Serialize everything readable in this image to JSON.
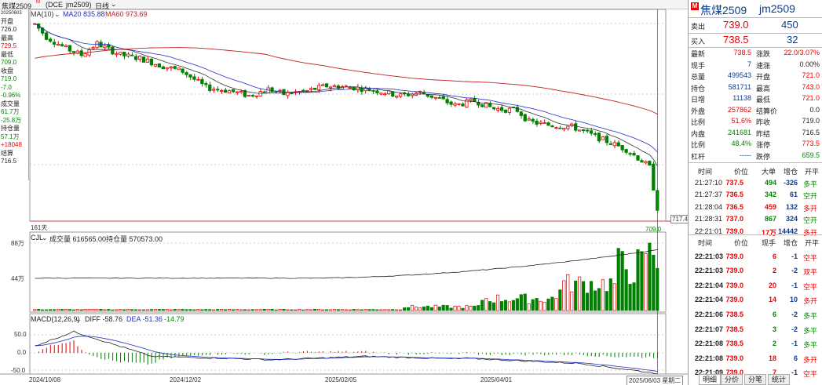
{
  "topbar": {
    "title": "焦煤2509",
    "title_sup": "M",
    "exchange": "(DCE",
    "symbol": "jm2509)",
    "period": "日线",
    "ma10": "MA(10)",
    "ma20": "MA20 835.88",
    "ma60": "MA60 973.69"
  },
  "ohlc_panel": [
    {
      "text": "20250603",
      "color": "#222"
    },
    {
      "text": "开盘",
      "color": "#222"
    },
    {
      "text": "726.0",
      "color": "#222"
    },
    {
      "text": "最高",
      "color": "#222"
    },
    {
      "text": "729.5",
      "color": "#e00"
    },
    {
      "text": "最低",
      "color": "#222"
    },
    {
      "text": "709.0",
      "color": "#080"
    },
    {
      "text": "收盘",
      "color": "#222"
    },
    {
      "text": "719.0",
      "color": "#080"
    },
    {
      "text": "-7.0",
      "color": "#080"
    },
    {
      "text": "-0.96%",
      "color": "#080"
    },
    {
      "text": "成交量",
      "color": "#222"
    },
    {
      "text": "61.7万",
      "color": "#080"
    },
    {
      "text": "-25.8万",
      "color": "#080"
    },
    {
      "text": "持仓量",
      "color": "#222"
    },
    {
      "text": "57.1万",
      "color": "#080"
    },
    {
      "text": "+18048",
      "color": "#e00"
    },
    {
      "text": "结算",
      "color": "#222"
    },
    {
      "text": "716.5",
      "color": "#222"
    }
  ],
  "main_chart": {
    "days_label": "161天",
    "last_price_label": "717.4",
    "low_label": "709.0"
  },
  "volume_panel": {
    "label": "CJL",
    "volume_text": "成交量 616565.00",
    "oi_text": "持仓量 570573.00",
    "tick_top": "88万",
    "tick_mid": "44万"
  },
  "macd_panel": {
    "label": "MACD(12,26,9)",
    "diff": "DIFF -58.76",
    "dea": "DEA -51.36",
    "macd": "-14.79",
    "tick_top": "50.0",
    "tick_mid": "0.0",
    "tick_bot": "-50.0"
  },
  "x_axis": {
    "labels": [
      "2024/10/08",
      "2024/12/02",
      "2025/02/05",
      "2025/04/01"
    ],
    "cursor_label": "2025/06/03 星期二"
  },
  "quote": {
    "badge": "M",
    "name": "焦煤2509",
    "code": "jm2509",
    "sell_label": "卖出",
    "sell_price": "739.0",
    "sell_qty": "450",
    "buy_label": "买入",
    "buy_price": "738.5",
    "buy_qty": "32",
    "stats": [
      {
        "l": "最新",
        "v": "738.5",
        "vc": "#e00",
        "l2": "涨跌",
        "v2": "22.0/3.07%",
        "v2c": "#e00"
      },
      {
        "l": "现手",
        "v": "7",
        "vc": "#0a3d91",
        "l2": "速涨",
        "v2": "0.00%",
        "v2c": "#222"
      },
      {
        "l": "总量",
        "v": "499543",
        "vc": "#0a3d91",
        "l2": "开盘",
        "v2": "721.0",
        "v2c": "#e00"
      },
      {
        "l": "持仓",
        "v": "581711",
        "vc": "#0a3d91",
        "l2": "最高",
        "v2": "743.0",
        "v2c": "#e00"
      },
      {
        "l": "日增",
        "v": "11138",
        "vc": "#0a3d91",
        "l2": "最低",
        "v2": "721.0",
        "v2c": "#e00"
      },
      {
        "l": "外盘",
        "v": "257862",
        "vc": "#e00",
        "l2": "结算价",
        "v2": "0.0",
        "v2c": "#222"
      },
      {
        "l": "比例",
        "v": "51.6%",
        "vc": "#e00",
        "l2": "昨收",
        "v2": "719.0",
        "v2c": "#222"
      },
      {
        "l": "内盘",
        "v": "241681",
        "vc": "#080",
        "l2": "昨结",
        "v2": "716.5",
        "v2c": "#222"
      },
      {
        "l": "比例",
        "v": "48.4%",
        "vc": "#080",
        "l2": "涨停",
        "v2": "773.5",
        "v2c": "#e00"
      },
      {
        "l": "杠杆",
        "v": "-----",
        "vc": "#0a3d91",
        "l2": "跌停",
        "v2": "659.5",
        "v2c": "#080"
      }
    ]
  },
  "big_orders": {
    "headers": [
      "时间",
      "价位",
      "大单",
      "增仓",
      "开平"
    ],
    "rows": [
      {
        "t": "21:27:10",
        "p": "737.5",
        "pc": "#e00",
        "q": "494",
        "qc": "#080",
        "d": "-326",
        "o": "多平",
        "oc": "#080"
      },
      {
        "t": "21:27:37",
        "p": "736.5",
        "pc": "#e00",
        "q": "342",
        "qc": "#080",
        "d": "61",
        "o": "空开",
        "oc": "#080"
      },
      {
        "t": "21:28:04",
        "p": "736.5",
        "pc": "#e00",
        "q": "459",
        "qc": "#e00",
        "d": "132",
        "o": "多开",
        "oc": "#e00"
      },
      {
        "t": "21:28:31",
        "p": "737.0",
        "pc": "#e00",
        "q": "867",
        "qc": "#080",
        "d": "324",
        "o": "空开",
        "oc": "#080"
      },
      {
        "t": "22:21:01",
        "p": "739.0",
        "pc": "#e00",
        "q": "17万",
        "qc": "#e00",
        "d": "14442",
        "o": "多开",
        "oc": "#e00"
      }
    ]
  },
  "ticks": {
    "headers": [
      "时间",
      "价位",
      "现手",
      "增仓",
      "开平"
    ],
    "rows": [
      {
        "t": "22:21:03",
        "p": "739.0",
        "q": "6",
        "qc": "#e00",
        "d": "-1",
        "o": "空平",
        "oc": "#e00"
      },
      {
        "t": "22:21:03",
        "p": "739.0",
        "q": "2",
        "qc": "#e00",
        "d": "-2",
        "o": "双平",
        "oc": "#e00"
      },
      {
        "t": "22:21:04",
        "p": "739.0",
        "q": "20",
        "qc": "#e00",
        "d": "-1",
        "o": "空平",
        "oc": "#e00"
      },
      {
        "t": "22:21:04",
        "p": "739.0",
        "q": "14",
        "qc": "#e00",
        "d": "10",
        "o": "多开",
        "oc": "#e00"
      },
      {
        "t": "22:21:06",
        "p": "738.5",
        "q": "6",
        "qc": "#080",
        "d": "-2",
        "o": "多平",
        "oc": "#080"
      },
      {
        "t": "22:21:07",
        "p": "738.5",
        "q": "3",
        "qc": "#080",
        "d": "-2",
        "o": "多平",
        "oc": "#080"
      },
      {
        "t": "22:21:08",
        "p": "738.5",
        "q": "2",
        "qc": "#080",
        "d": "-1",
        "o": "多平",
        "oc": "#080"
      },
      {
        "t": "22:21:08",
        "p": "739.0",
        "q": "18",
        "qc": "#e00",
        "d": "6",
        "o": "多开",
        "oc": "#e00"
      },
      {
        "t": "22:21:09",
        "p": "739.0",
        "q": "7",
        "qc": "#e00",
        "d": "-1",
        "o": "空平",
        "oc": "#e00"
      }
    ]
  },
  "tabs": [
    "明细",
    "分价",
    "分笔",
    "统计"
  ],
  "colors": {
    "up": "#e00000",
    "down": "#008000",
    "ma10": "#333333",
    "ma20": "#2030c0",
    "ma60": "#c02020"
  }
}
